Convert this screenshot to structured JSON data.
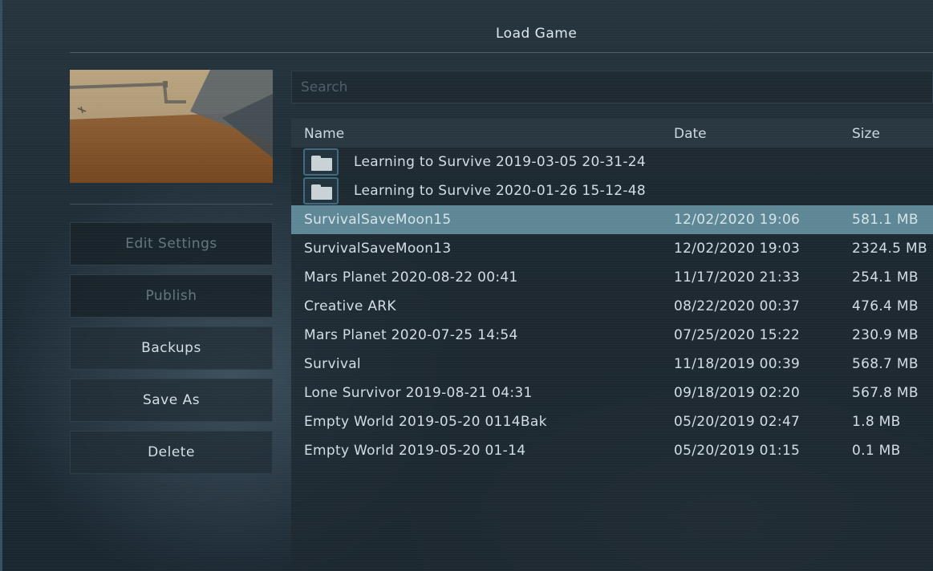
{
  "window": {
    "title": "Load Game"
  },
  "search": {
    "placeholder": "Search",
    "value": ""
  },
  "sidebar": {
    "buttons": [
      {
        "label": "Edit Settings",
        "enabled": false
      },
      {
        "label": "Publish",
        "enabled": false
      },
      {
        "label": "Backups",
        "enabled": true
      },
      {
        "label": "Save As",
        "enabled": true
      },
      {
        "label": "Delete",
        "enabled": true
      }
    ]
  },
  "table": {
    "columns": {
      "name": "Name",
      "date": "Date",
      "size": "Size"
    },
    "folders": [
      {
        "name": "Learning to Survive 2019-03-05 20-31-24",
        "icon": "folder-icon"
      },
      {
        "name": "Learning to Survive 2020-01-26 15-12-48",
        "icon": "folder-icon"
      }
    ],
    "rows": [
      {
        "name": "SurvivalSaveMoon15",
        "date": "12/02/2020 19:06",
        "size": "581.1 MB",
        "selected": true
      },
      {
        "name": "SurvivalSaveMoon13",
        "date": "12/02/2020 19:03",
        "size": "2324.5 MB"
      },
      {
        "name": "Mars Planet 2020-08-22 00:41",
        "date": "11/17/2020 21:33",
        "size": "254.1 MB"
      },
      {
        "name": "Creative ARK",
        "date": "08/22/2020 00:37",
        "size": "476.4 MB"
      },
      {
        "name": "Mars Planet 2020-07-25 14:54",
        "date": "07/25/2020 15:22",
        "size": "230.9 MB"
      },
      {
        "name": "Survival",
        "date": "11/18/2019 00:39",
        "size": "568.7 MB"
      },
      {
        "name": "Lone Survivor 2019-08-21 04:31",
        "date": "09/18/2019 02:20",
        "size": "567.8 MB"
      },
      {
        "name": "Empty World 2019-05-20 0114Bak",
        "date": "05/20/2019 02:47",
        "size": "1.8 MB"
      },
      {
        "name": "Empty World 2019-05-20 01-14",
        "date": "05/20/2019 01:15",
        "size": "0.1 MB"
      }
    ]
  },
  "colors": {
    "selected_row": "#5e8796",
    "disabled_text": "#66757d",
    "folder_border": "#3e6a80"
  }
}
